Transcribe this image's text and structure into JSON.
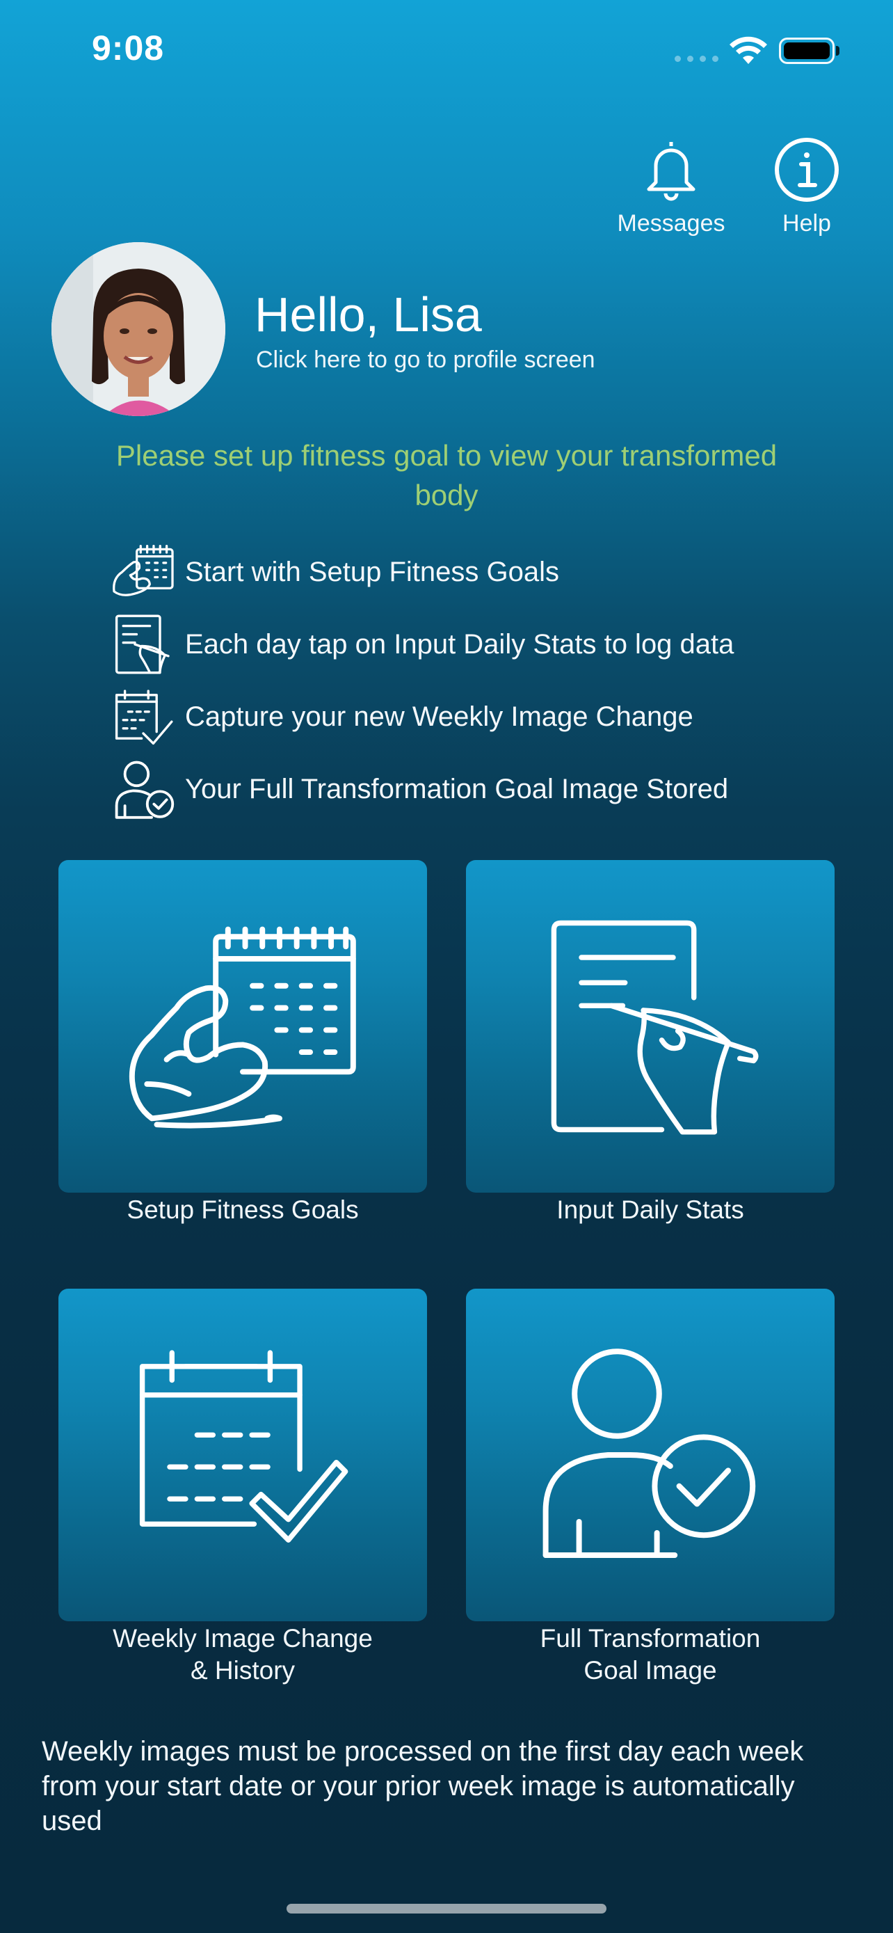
{
  "status_bar": {
    "time": "9:08"
  },
  "top_actions": {
    "messages_label": "Messages",
    "help_label": "Help"
  },
  "profile": {
    "greeting": "Hello, Lisa",
    "subtitle": "Click here to go to profile screen"
  },
  "notice": "Please set up fitness goal to view your transformed body",
  "steps": [
    {
      "icon": "muscle-calendar-icon",
      "text": "Start with Setup Fitness Goals"
    },
    {
      "icon": "document-writing-icon",
      "text": "Each day tap on Input Daily Stats to log data"
    },
    {
      "icon": "calendar-check-icon",
      "text": "Capture your new Weekly Image Change"
    },
    {
      "icon": "user-check-icon",
      "text": "Your Full Transformation Goal Image Stored"
    }
  ],
  "tiles": [
    {
      "icon": "muscle-calendar-icon",
      "label": "Setup Fitness Goals"
    },
    {
      "icon": "document-writing-icon",
      "label": "Input Daily Stats"
    },
    {
      "icon": "calendar-check-icon",
      "label_line1": "Weekly Image Change",
      "label_line2": "& History"
    },
    {
      "icon": "user-check-icon",
      "label_line1": "Full Transformation",
      "label_line2": "Goal Image"
    }
  ],
  "footer": "Weekly images must be processed on the first day each week from your start date or your prior week image is automatically used",
  "colors": {
    "notice": "#9fcf74",
    "tile_top": "#1296c9",
    "background_bottom": "#072a3e"
  }
}
